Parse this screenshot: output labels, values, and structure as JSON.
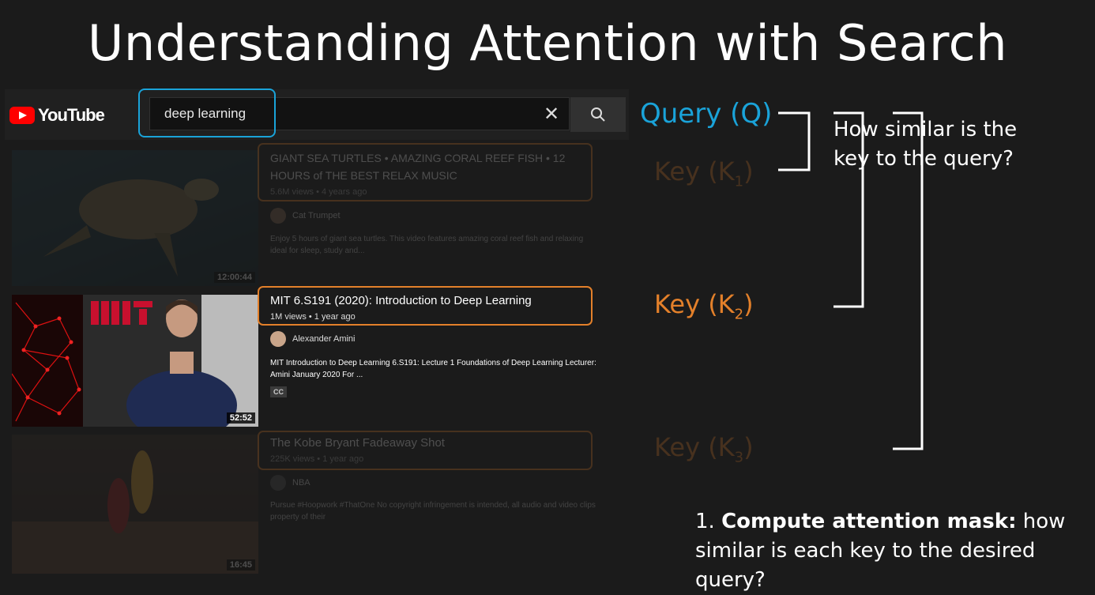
{
  "slide": {
    "title": "Understanding Attention with Search"
  },
  "youtube": {
    "logo_text": "YouTube",
    "search_value": "deep learning",
    "clear_icon": "close-icon",
    "search_icon": "search-icon"
  },
  "results": [
    {
      "title_line1": "GIANT SEA TURTLES • AMAZING CORAL REEF FISH • 12",
      "title_line2": "HOURS of THE BEST RELAX MUSIC",
      "meta": "5.6M views • 4 years ago",
      "channel": "Cat Trumpet",
      "desc": "Enjoy 5 hours of giant sea turtles. This video features amazing coral reef fish and relaxing",
      "desc2": "ideal for sleep, study and...",
      "duration": "12:00:44"
    },
    {
      "title": "MIT 6.S191 (2020): Introduction to Deep Learning",
      "meta": "1M views • 1 year ago",
      "channel": "Alexander Amini",
      "desc": "MIT Introduction to Deep Learning 6.S191: Lecture 1 Foundations of Deep Learning Lecturer:",
      "desc2": "Amini January 2020 For ...",
      "badge": "CC",
      "duration": "52:52"
    },
    {
      "title": "The Kobe Bryant Fadeaway Shot",
      "meta": "225K views • 1 year ago",
      "channel": "NBA",
      "desc": "Pursue #Hoopwork #ThatOne No copyright infringement is intended, all audio and video clips",
      "desc2": "property of their",
      "duration": "16:45"
    }
  ],
  "annotations": {
    "query": "Query (Q)",
    "key1": "Key (K",
    "key1_sub": "1",
    "key2": "Key (K",
    "key2_sub": "2",
    "key3": "Key (K",
    "key3_sub": "3",
    "close_paren": ")",
    "note1_line1": "How similar is the",
    "note1_line2": "key to the query?",
    "note2_num": "1.",
    "note2_bold": "Compute attention mask:",
    "note2_rest": "how",
    "note2_line2": "similar is each key to the desired query?"
  },
  "colors": {
    "query": "#1aa3d9",
    "key": "#e3802a",
    "background": "#1b1b1b"
  }
}
